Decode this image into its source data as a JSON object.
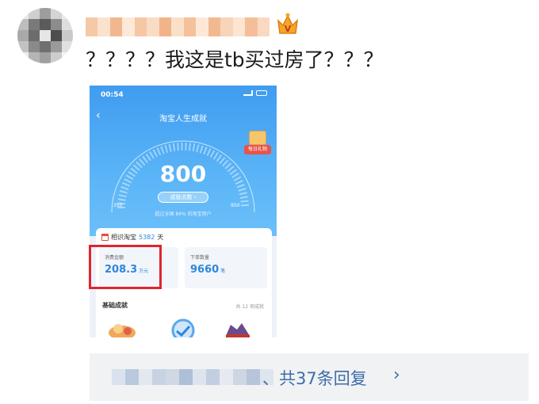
{
  "comment": {
    "text": "？？？？我这是tb买过房了？？？",
    "avatar_icon": "pixelated-avatar",
    "username_icon": "pixelated-username",
    "badge_icon": "crown-icon"
  },
  "screenshot": {
    "status_time": "00:54",
    "title": "淘宝人生成就",
    "score": "800",
    "achievement_button": "成就点数 ›",
    "gauge_min": "350",
    "gauge_max": "950",
    "beat_text": "超过全国 84% 的淘宝用户",
    "gift_label": "每日礼物",
    "know_label": "相识淘宝",
    "know_days": "5382",
    "know_unit": "天",
    "spend_label": "消费金额",
    "spend_value": "208.3",
    "spend_unit": "万元",
    "orders_label": "下单数量",
    "orders_value": "9660",
    "orders_unit": "笔",
    "basic_title": "基础成就",
    "basic_count": "共 12 项成就",
    "highlight_color": "#e0242f"
  },
  "replies": {
    "label": "、共37条回复",
    "arrow_icon": "chevron-right-icon",
    "link_color": "#3e6da8"
  }
}
